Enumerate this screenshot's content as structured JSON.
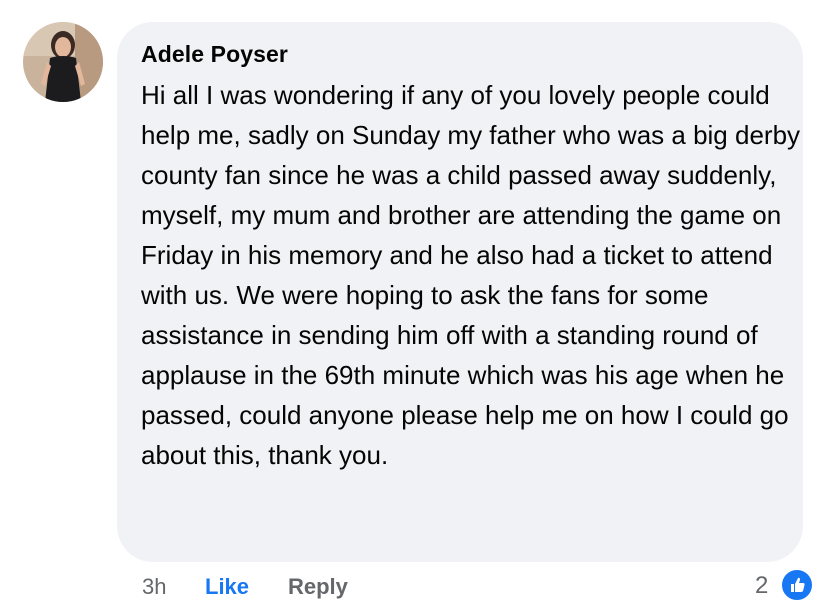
{
  "comment": {
    "author": "Adele Poyser",
    "text": "Hi all I was wondering if any of you lovely people could help me, sadly on Sunday my father who was a big derby county fan since he was a child passed away suddenly, myself, my mum and brother are attending the game on Friday in his memory and he also had a ticket to attend with us. We were hoping to ask the fans for some assistance in sending him off with a standing round of applause in the 69th minute which was his age when he passed, could anyone please help me on how I could go about this, thank you.",
    "timestamp": "3h",
    "like_label": "Like",
    "reply_label": "Reply",
    "reaction_count": "2",
    "reaction_icon": "thumbs-up-icon"
  },
  "colors": {
    "bubble_background": "#f0f2f5",
    "like_link": "#1877f2",
    "meta_text": "#65676b",
    "reaction_badge": "#1877f2"
  }
}
